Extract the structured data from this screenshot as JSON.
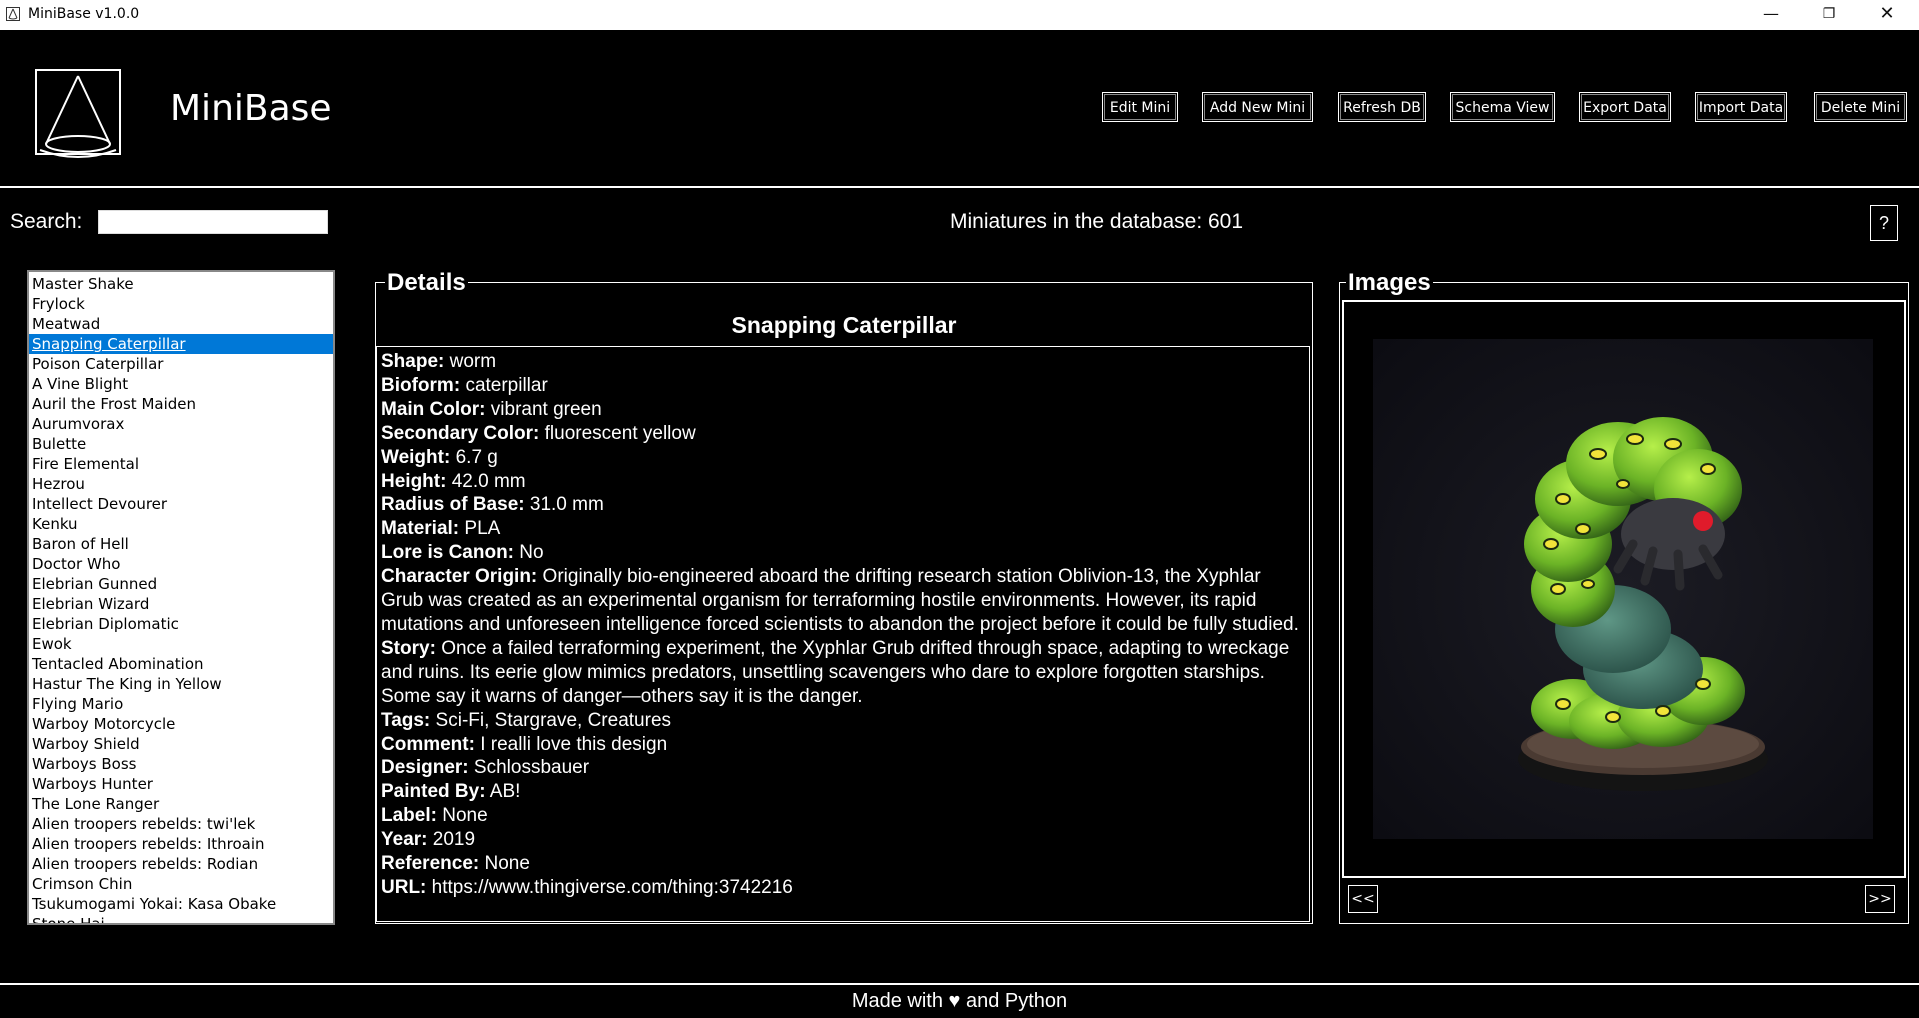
{
  "window": {
    "title": "MiniBase v1.0.0",
    "minimize": "—",
    "maximize": "❐",
    "close": "✕"
  },
  "header": {
    "app_name": "MiniBase"
  },
  "toolbar": {
    "edit": "Edit Mini",
    "add": "Add New Mini",
    "refresh": "Refresh DB",
    "schema": "Schema View",
    "export": "Export Data",
    "import": "Import Data",
    "delete": "Delete Mini"
  },
  "search": {
    "label": "Search:",
    "value": ""
  },
  "status": {
    "count_text": "Miniatures in the database: 601"
  },
  "help_label": "?",
  "list": {
    "selected_index": 3,
    "items": [
      "Master Shake",
      "Frylock",
      "Meatwad",
      "Snapping Caterpillar",
      "Poison Caterpillar",
      "A Vine Blight",
      "Auril the Frost Maiden",
      "Aurumvorax",
      "Bulette",
      "Fire Elemental",
      "Hezrou",
      "Intellect Devourer",
      "Kenku",
      "Baron of Hell",
      "Doctor Who",
      "Elebrian Gunned",
      "Elebrian Wizard",
      "Elebrian Diplomatic",
      "Ewok",
      "Tentacled Abomination",
      "Hastur The King in Yellow",
      "Flying Mario",
      "Warboy Motorcycle",
      "Warboy Shield",
      "Warboys Boss",
      "Warboys Hunter",
      "The Lone Ranger",
      "Alien troopers rebelds: twi'lek",
      "Alien troopers rebelds: Ithroain",
      "Alien troopers rebelds: Rodian",
      "Crimson Chin",
      "Tsukumogami Yokai: Kasa Obake",
      "Stone Hai"
    ]
  },
  "details": {
    "frame_title": "Details",
    "name": "Snapping Caterpillar",
    "fields": [
      {
        "label": "Shape:",
        "value": "worm"
      },
      {
        "label": "Bioform:",
        "value": "caterpillar"
      },
      {
        "label": "Main Color:",
        "value": "vibrant green"
      },
      {
        "label": "Secondary Color:",
        "value": "fluorescent yellow"
      },
      {
        "label": "Weight:",
        "value": "6.7 g"
      },
      {
        "label": "Height:",
        "value": "42.0 mm"
      },
      {
        "label": "Radius of Base:",
        "value": "31.0 mm"
      },
      {
        "label": "Material:",
        "value": "PLA"
      },
      {
        "label": "Lore is Canon:",
        "value": "No"
      },
      {
        "label": "Character Origin:",
        "value": "Originally bio-engineered aboard the drifting research station Oblivion-13, the Xyphlar Grub was created as an experimental organism for terraforming hostile environments. However, its rapid mutations and unforeseen intelligence forced scientists to abandon the project before it could be fully studied."
      },
      {
        "label": "Story:",
        "value": "Once a failed terraforming experiment, the Xyphlar Grub drifted through space, adapting to wreckage and ruins. Its eerie glow mimics predators, unsettling scavengers who dare to explore forgotten starships. Some say it warns of danger—others say it is the danger."
      },
      {
        "label": "Tags:",
        "value": "Sci-Fi, Stargrave, Creatures"
      },
      {
        "label": "Comment:",
        "value": "I realli love this design"
      },
      {
        "label": "Designer:",
        "value": "Schlossbauer"
      },
      {
        "label": "Painted By:",
        "value": "AB!"
      },
      {
        "label": "Label:",
        "value": "None"
      },
      {
        "label": "Year:",
        "value": "2019"
      },
      {
        "label": "Reference:",
        "value": "None"
      },
      {
        "label": "URL:",
        "value": "https://www.thingiverse.com/thing:3742216"
      }
    ]
  },
  "images": {
    "frame_title": "Images",
    "prev": "<<",
    "next": ">>"
  },
  "footer": {
    "text": "Made with ♥ and Python"
  },
  "colors": {
    "background": "#000000",
    "selection": "#0078d7",
    "caterpillar_green": "#7cc22a",
    "caterpillar_body": "#3f6f62"
  }
}
